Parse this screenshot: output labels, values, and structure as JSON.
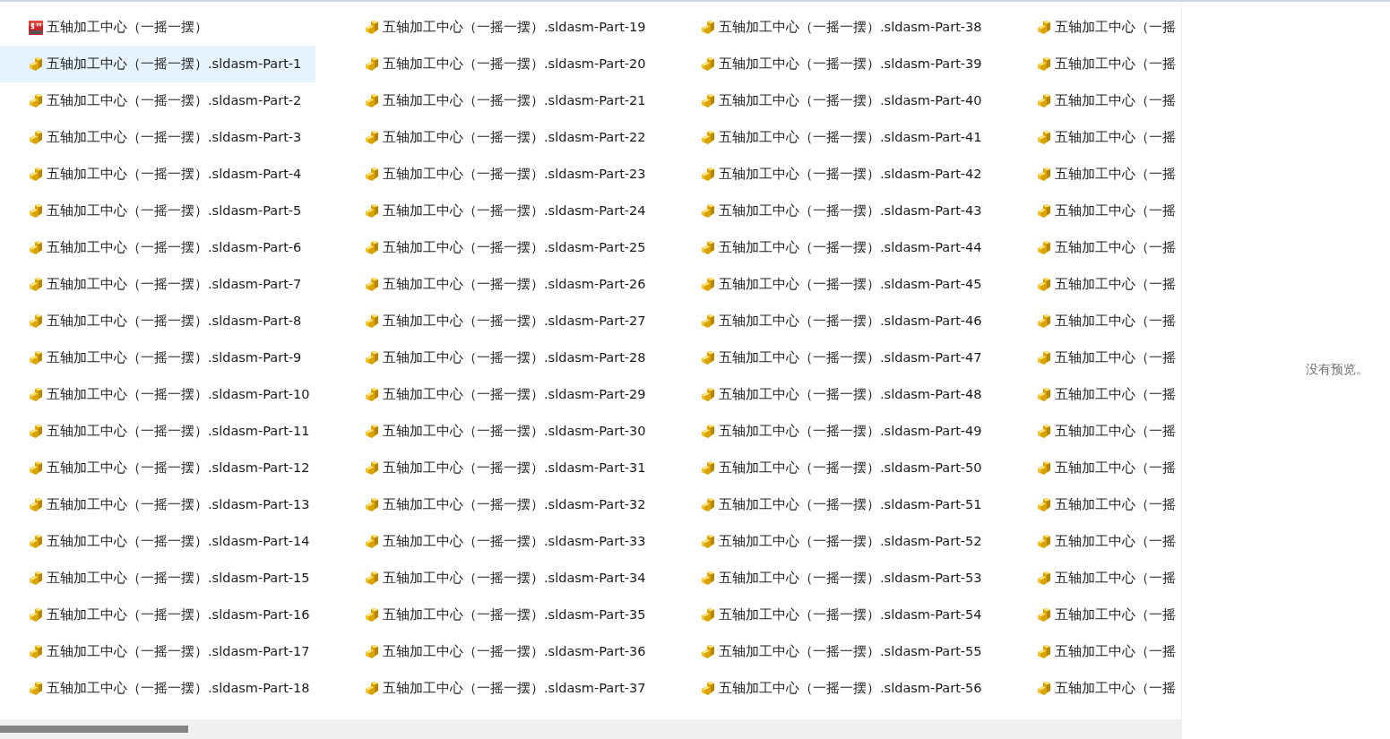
{
  "files": [
    {
      "name": "五轴加工中心（一摇一摆）",
      "kind": "assembly",
      "selected": false
    },
    {
      "name": "五轴加工中心（一摇一摆）.sldasm-Part-1",
      "kind": "part",
      "selected": true
    },
    {
      "name": "五轴加工中心（一摇一摆）.sldasm-Part-2",
      "kind": "part",
      "selected": false
    },
    {
      "name": "五轴加工中心（一摇一摆）.sldasm-Part-3",
      "kind": "part",
      "selected": false
    },
    {
      "name": "五轴加工中心（一摇一摆）.sldasm-Part-4",
      "kind": "part",
      "selected": false
    },
    {
      "name": "五轴加工中心（一摇一摆）.sldasm-Part-5",
      "kind": "part",
      "selected": false
    },
    {
      "name": "五轴加工中心（一摇一摆）.sldasm-Part-6",
      "kind": "part",
      "selected": false
    },
    {
      "name": "五轴加工中心（一摇一摆）.sldasm-Part-7",
      "kind": "part",
      "selected": false
    },
    {
      "name": "五轴加工中心（一摇一摆）.sldasm-Part-8",
      "kind": "part",
      "selected": false
    },
    {
      "name": "五轴加工中心（一摇一摆）.sldasm-Part-9",
      "kind": "part",
      "selected": false
    },
    {
      "name": "五轴加工中心（一摇一摆）.sldasm-Part-10",
      "kind": "part",
      "selected": false
    },
    {
      "name": "五轴加工中心（一摇一摆）.sldasm-Part-11",
      "kind": "part",
      "selected": false
    },
    {
      "name": "五轴加工中心（一摇一摆）.sldasm-Part-12",
      "kind": "part",
      "selected": false
    },
    {
      "name": "五轴加工中心（一摇一摆）.sldasm-Part-13",
      "kind": "part",
      "selected": false
    },
    {
      "name": "五轴加工中心（一摇一摆）.sldasm-Part-14",
      "kind": "part",
      "selected": false
    },
    {
      "name": "五轴加工中心（一摇一摆）.sldasm-Part-15",
      "kind": "part",
      "selected": false
    },
    {
      "name": "五轴加工中心（一摇一摆）.sldasm-Part-16",
      "kind": "part",
      "selected": false
    },
    {
      "name": "五轴加工中心（一摇一摆）.sldasm-Part-17",
      "kind": "part",
      "selected": false
    },
    {
      "name": "五轴加工中心（一摇一摆）.sldasm-Part-18",
      "kind": "part",
      "selected": false
    },
    {
      "name": "五轴加工中心（一摇一摆）.sldasm-Part-19",
      "kind": "part",
      "selected": false
    },
    {
      "name": "五轴加工中心（一摇一摆）.sldasm-Part-20",
      "kind": "part",
      "selected": false
    },
    {
      "name": "五轴加工中心（一摇一摆）.sldasm-Part-21",
      "kind": "part",
      "selected": false
    },
    {
      "name": "五轴加工中心（一摇一摆）.sldasm-Part-22",
      "kind": "part",
      "selected": false
    },
    {
      "name": "五轴加工中心（一摇一摆）.sldasm-Part-23",
      "kind": "part",
      "selected": false
    },
    {
      "name": "五轴加工中心（一摇一摆）.sldasm-Part-24",
      "kind": "part",
      "selected": false
    },
    {
      "name": "五轴加工中心（一摇一摆）.sldasm-Part-25",
      "kind": "part",
      "selected": false
    },
    {
      "name": "五轴加工中心（一摇一摆）.sldasm-Part-26",
      "kind": "part",
      "selected": false
    },
    {
      "name": "五轴加工中心（一摇一摆）.sldasm-Part-27",
      "kind": "part",
      "selected": false
    },
    {
      "name": "五轴加工中心（一摇一摆）.sldasm-Part-28",
      "kind": "part",
      "selected": false
    },
    {
      "name": "五轴加工中心（一摇一摆）.sldasm-Part-29",
      "kind": "part",
      "selected": false
    },
    {
      "name": "五轴加工中心（一摇一摆）.sldasm-Part-30",
      "kind": "part",
      "selected": false
    },
    {
      "name": "五轴加工中心（一摇一摆）.sldasm-Part-31",
      "kind": "part",
      "selected": false
    },
    {
      "name": "五轴加工中心（一摇一摆）.sldasm-Part-32",
      "kind": "part",
      "selected": false
    },
    {
      "name": "五轴加工中心（一摇一摆）.sldasm-Part-33",
      "kind": "part",
      "selected": false
    },
    {
      "name": "五轴加工中心（一摇一摆）.sldasm-Part-34",
      "kind": "part",
      "selected": false
    },
    {
      "name": "五轴加工中心（一摇一摆）.sldasm-Part-35",
      "kind": "part",
      "selected": false
    },
    {
      "name": "五轴加工中心（一摇一摆）.sldasm-Part-36",
      "kind": "part",
      "selected": false
    },
    {
      "name": "五轴加工中心（一摇一摆）.sldasm-Part-37",
      "kind": "part",
      "selected": false
    },
    {
      "name": "五轴加工中心（一摇一摆）.sldasm-Part-38",
      "kind": "part",
      "selected": false
    },
    {
      "name": "五轴加工中心（一摇一摆）.sldasm-Part-39",
      "kind": "part",
      "selected": false
    },
    {
      "name": "五轴加工中心（一摇一摆）.sldasm-Part-40",
      "kind": "part",
      "selected": false
    },
    {
      "name": "五轴加工中心（一摇一摆）.sldasm-Part-41",
      "kind": "part",
      "selected": false
    },
    {
      "name": "五轴加工中心（一摇一摆）.sldasm-Part-42",
      "kind": "part",
      "selected": false
    },
    {
      "name": "五轴加工中心（一摇一摆）.sldasm-Part-43",
      "kind": "part",
      "selected": false
    },
    {
      "name": "五轴加工中心（一摇一摆）.sldasm-Part-44",
      "kind": "part",
      "selected": false
    },
    {
      "name": "五轴加工中心（一摇一摆）.sldasm-Part-45",
      "kind": "part",
      "selected": false
    },
    {
      "name": "五轴加工中心（一摇一摆）.sldasm-Part-46",
      "kind": "part",
      "selected": false
    },
    {
      "name": "五轴加工中心（一摇一摆）.sldasm-Part-47",
      "kind": "part",
      "selected": false
    },
    {
      "name": "五轴加工中心（一摇一摆）.sldasm-Part-48",
      "kind": "part",
      "selected": false
    },
    {
      "name": "五轴加工中心（一摇一摆）.sldasm-Part-49",
      "kind": "part",
      "selected": false
    },
    {
      "name": "五轴加工中心（一摇一摆）.sldasm-Part-50",
      "kind": "part",
      "selected": false
    },
    {
      "name": "五轴加工中心（一摇一摆）.sldasm-Part-51",
      "kind": "part",
      "selected": false
    },
    {
      "name": "五轴加工中心（一摇一摆）.sldasm-Part-52",
      "kind": "part",
      "selected": false
    },
    {
      "name": "五轴加工中心（一摇一摆）.sldasm-Part-53",
      "kind": "part",
      "selected": false
    },
    {
      "name": "五轴加工中心（一摇一摆）.sldasm-Part-54",
      "kind": "part",
      "selected": false
    },
    {
      "name": "五轴加工中心（一摇一摆）.sldasm-Part-55",
      "kind": "part",
      "selected": false
    },
    {
      "name": "五轴加工中心（一摇一摆）.sldasm-Part-56",
      "kind": "part",
      "selected": false
    },
    {
      "name": "五轴加工中心（一摇",
      "kind": "part",
      "selected": false
    },
    {
      "name": "五轴加工中心（一摇",
      "kind": "part",
      "selected": false
    },
    {
      "name": "五轴加工中心（一摇",
      "kind": "part",
      "selected": false
    },
    {
      "name": "五轴加工中心（一摇",
      "kind": "part",
      "selected": false
    },
    {
      "name": "五轴加工中心（一摇",
      "kind": "part",
      "selected": false
    },
    {
      "name": "五轴加工中心（一摇",
      "kind": "part",
      "selected": false
    },
    {
      "name": "五轴加工中心（一摇",
      "kind": "part",
      "selected": false
    },
    {
      "name": "五轴加工中心（一摇",
      "kind": "part",
      "selected": false
    },
    {
      "name": "五轴加工中心（一摇",
      "kind": "part",
      "selected": false
    },
    {
      "name": "五轴加工中心（一摇",
      "kind": "part",
      "selected": false
    },
    {
      "name": "五轴加工中心（一摇",
      "kind": "part",
      "selected": false
    },
    {
      "name": "五轴加工中心（一摇",
      "kind": "part",
      "selected": false
    },
    {
      "name": "五轴加工中心（一摇",
      "kind": "part",
      "selected": false
    },
    {
      "name": "五轴加工中心（一摇",
      "kind": "part",
      "selected": false
    },
    {
      "name": "五轴加工中心（一摇",
      "kind": "part",
      "selected": false
    },
    {
      "name": "五轴加工中心（一摇",
      "kind": "part",
      "selected": false
    },
    {
      "name": "五轴加工中心（一摇",
      "kind": "part",
      "selected": false
    },
    {
      "name": "五轴加工中心（一摇",
      "kind": "part",
      "selected": false
    },
    {
      "name": "五轴加工中心（一摇",
      "kind": "part",
      "selected": false
    }
  ],
  "preview": {
    "message": "没有预览。"
  }
}
